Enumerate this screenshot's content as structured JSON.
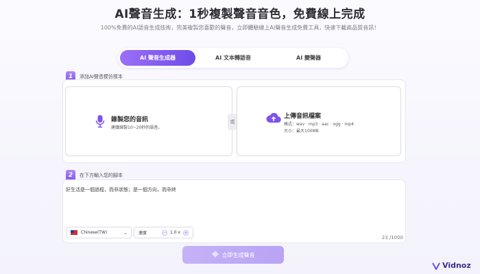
{
  "header": {
    "title": "AI聲音生成：1秒複製聲音音色，免費線上完成",
    "subtitle": "100%免費的AI語音生成技術，完美複製您喜歡的聲音，立即體驗線上AI聲音生成免費工具，快速下載高品質音訊！"
  },
  "tabs": [
    {
      "label": "AI 聲音生成器",
      "active": true
    },
    {
      "label": "AI 文本轉語音",
      "active": false
    },
    {
      "label": "AI 變聲器",
      "active": false
    }
  ],
  "step1": {
    "number": "1",
    "label": "添加AI聲音模仿樣本",
    "record": {
      "title": "錄製您的音訊",
      "hint": "建議錄製10~20秒的語音。"
    },
    "or_label": "或",
    "upload": {
      "title": "上傳音訊檔案",
      "formats": "格式：wav · mp3 · aac · ogg · mp4",
      "size": "大小：最大100MB"
    }
  },
  "step2": {
    "number": "2",
    "label": "在下方輸入您的腳本",
    "script": "好生活是一個過程，而非狀態；是一個方向，而非終",
    "counter": "23 /1000",
    "language": "Chinese(TW)",
    "speed_label": "速度",
    "speed_value": "1.0 x"
  },
  "generate_button": "立即生成聲音",
  "brand": "Vidnoz",
  "colors": {
    "accent": "#7d55ea",
    "button": "#c5b2f7",
    "brand_text": "#3d2a8a"
  }
}
